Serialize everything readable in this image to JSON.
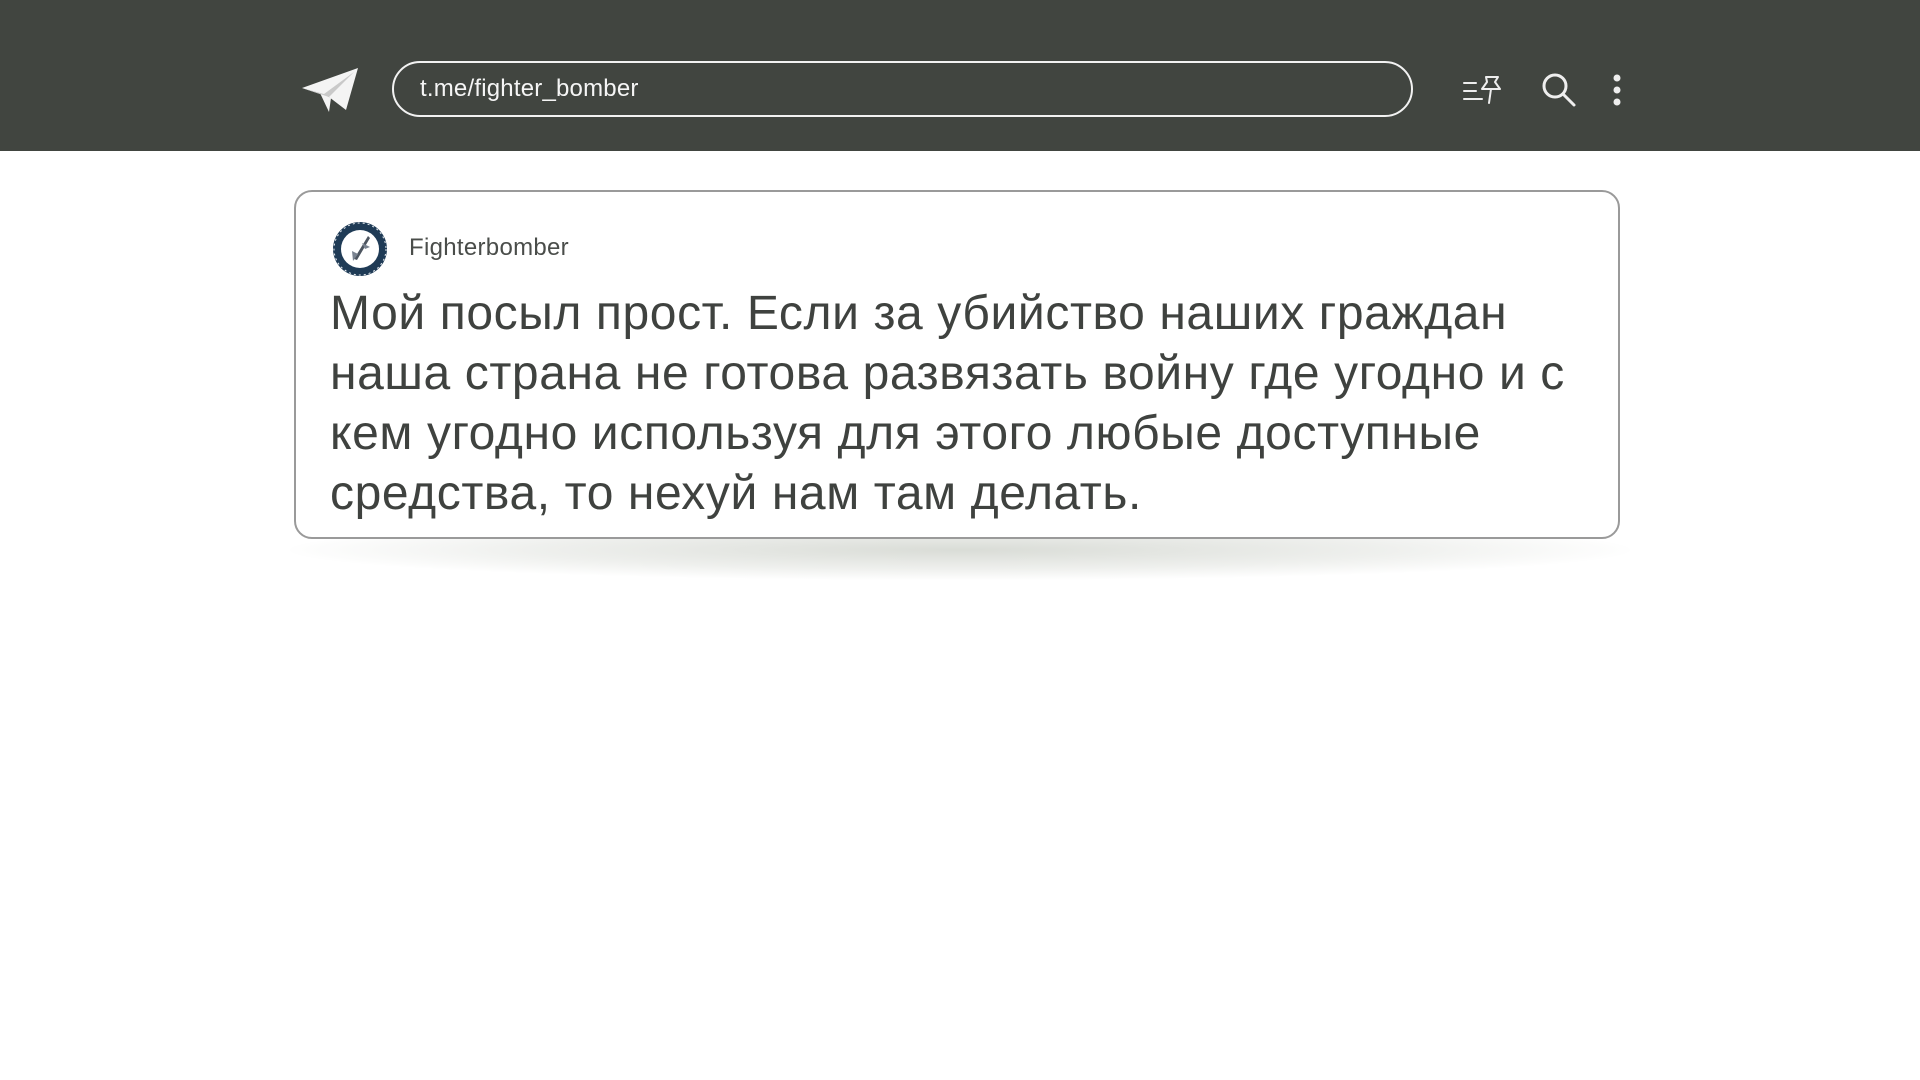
{
  "header": {
    "url": "t.me/fighter_bomber",
    "logo_icon": "telegram-plane-icon",
    "pinned_icon": "pinned-messages-icon",
    "search_icon": "search-icon",
    "menu_icon": "more-vertical-icon",
    "background_color": "#414540"
  },
  "post": {
    "author": "Fighterbomber",
    "avatar_icon": "fighterbomber-avatar",
    "text": "Мой посыл прост. Если за убийство наших граждан наша страна не готова развязать войну где угодно и с кем угодно используя для этого любые доступные средства, то нехуй нам там делать."
  }
}
